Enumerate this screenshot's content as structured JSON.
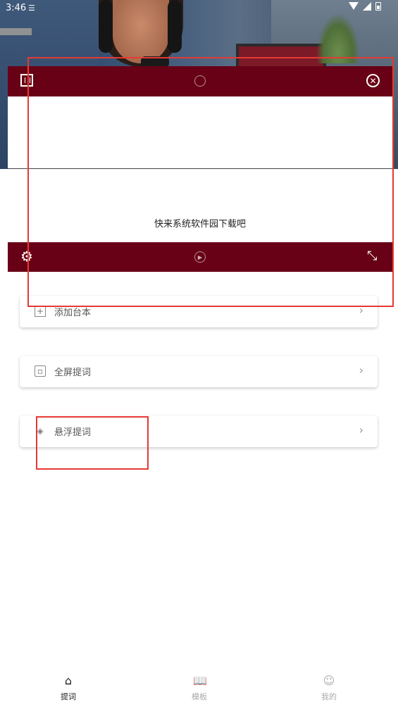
{
  "status_bar": {
    "time": "3:46",
    "notification_icon": "document-icon"
  },
  "prompter": {
    "script_text": "快来系统软件园下载吧",
    "top_icons": [
      "fullscreen-frame-icon",
      "rotate-icon",
      "close-circle-icon"
    ],
    "bottom_icons": [
      "gear-icon",
      "play-circle-icon",
      "expand-diagonal-icon"
    ],
    "accent_color": "#680016"
  },
  "menu": {
    "items": [
      {
        "label": "添加台本",
        "icon": "plus-box-icon"
      },
      {
        "label": "全屏提词",
        "icon": "fullscreen-icon"
      },
      {
        "label": "悬浮提词",
        "icon": "layers-icon"
      }
    ]
  },
  "bottom_nav": {
    "items": [
      {
        "label": "提词",
        "icon": "home-icon",
        "active": true
      },
      {
        "label": "模板",
        "icon": "book-icon",
        "active": false
      },
      {
        "label": "我的",
        "icon": "face-icon",
        "active": false
      }
    ]
  },
  "annotation_color": "#e53935"
}
